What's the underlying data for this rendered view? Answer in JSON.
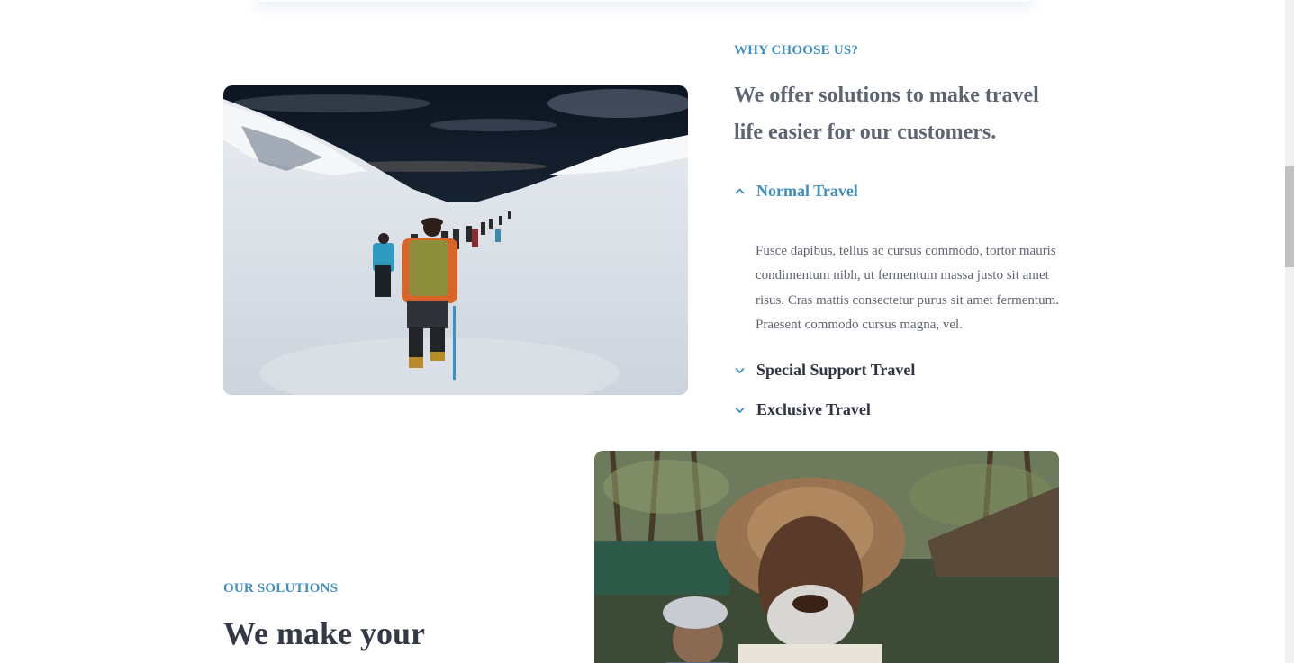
{
  "colors": {
    "accent": "#3f8fc1",
    "heading": "#5d6573",
    "dark_heading": "#333945",
    "body_text": "#5f6570"
  },
  "why": {
    "eyebrow": "WHY CHOOSE US?",
    "heading": "We offer solutions to make travel life easier for our customers.",
    "accordion": [
      {
        "title": "Normal Travel",
        "state": "expanded",
        "icon": "chevron-up-icon",
        "body": "Fusce dapibus, tellus ac cursus commodo, tortor mauris condimentum nibh, ut fermentum massa justo sit amet risus. Cras mattis consectetur purus sit amet fermentum. Praesent commodo cursus magna, vel."
      },
      {
        "title": "Special Support Travel",
        "state": "collapsed",
        "icon": "chevron-down-icon"
      },
      {
        "title": "Exclusive Travel",
        "state": "collapsed",
        "icon": "chevron-down-icon"
      }
    ]
  },
  "solutions": {
    "eyebrow": "OUR SOLUTIONS",
    "heading": "We make your"
  }
}
